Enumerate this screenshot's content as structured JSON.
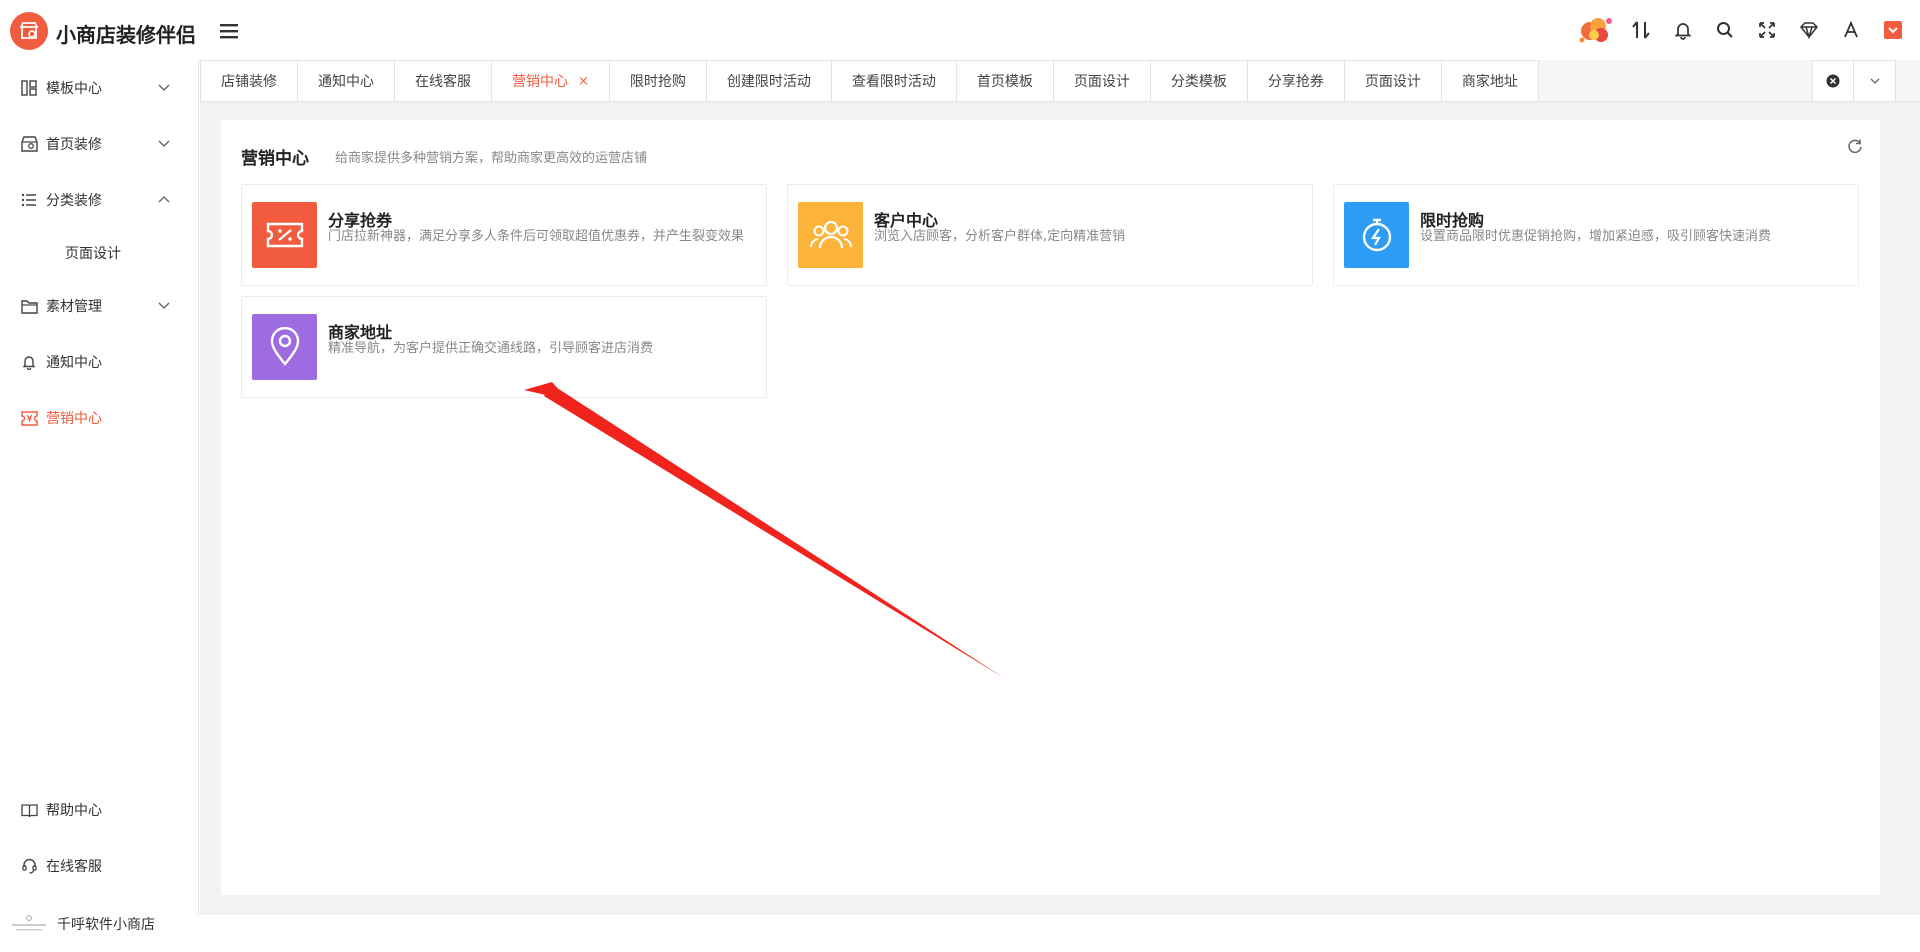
{
  "app": {
    "title": "小商店装修伴侣"
  },
  "colors": {
    "accent": "#f15b3e",
    "orange": "#fbb33a",
    "blue": "#2d9cf5",
    "purple": "#9d6ce0",
    "arrow": "#f0241c"
  },
  "toolbar": {
    "icons": [
      "avatar",
      "sort-icon",
      "bell-icon",
      "search-icon",
      "fullscreen-icon",
      "diamond-icon",
      "font-icon",
      "theme-icon"
    ]
  },
  "sidebar": {
    "items": [
      {
        "label": "模板中心",
        "icon": "template-icon",
        "expandable": true
      },
      {
        "label": "首页装修",
        "icon": "home-decor-icon",
        "expandable": true
      },
      {
        "label": "分类装修",
        "icon": "list-icon",
        "expandable": true,
        "expanded": true
      },
      {
        "label": "页面设计",
        "sub": true
      },
      {
        "label": "素材管理",
        "icon": "folder-icon",
        "expandable": true
      },
      {
        "label": "通知中心",
        "icon": "bell-icon"
      },
      {
        "label": "营销中心",
        "icon": "ticket-icon",
        "active": true
      }
    ],
    "bottom": [
      {
        "label": "帮助中心",
        "icon": "book-icon"
      },
      {
        "label": "在线客服",
        "icon": "headset-icon"
      },
      {
        "label": "千呼软件小商店",
        "icon": "brand-logo"
      }
    ]
  },
  "tabs": [
    {
      "label": "店铺装修"
    },
    {
      "label": "通知中心"
    },
    {
      "label": "在线客服"
    },
    {
      "label": "营销中心",
      "active": true,
      "close": "×"
    },
    {
      "label": "限时抢购"
    },
    {
      "label": "创建限时活动"
    },
    {
      "label": "查看限时活动"
    },
    {
      "label": "首页模板"
    },
    {
      "label": "页面设计"
    },
    {
      "label": "分类模板"
    },
    {
      "label": "分享抢券"
    },
    {
      "label": "页面设计"
    },
    {
      "label": "商家地址"
    }
  ],
  "page": {
    "title": "营销中心",
    "description": "给商家提供多种营销方案，帮助商家更高效的运营店铺"
  },
  "cards": [
    {
      "title": "分享抢券",
      "desc": "门店拉新神器，满足分享多人条件后可领取超值优惠券，并产生裂变效果",
      "icon": "coupon-icon",
      "color": "#f15b3e"
    },
    {
      "title": "客户中心",
      "desc": "浏览入店顾客，分析客户群体,定向精准营销",
      "icon": "users-icon",
      "color": "#fbb33a"
    },
    {
      "title": "限时抢购",
      "desc": "设置商品限时优惠促销抢购，增加紧迫感，吸引顾客快速消费",
      "icon": "stopwatch-icon",
      "color": "#2d9cf5"
    },
    {
      "title": "商家地址",
      "desc": "精准导航，为客户提供正确交通线路，引导顾客进店消费",
      "icon": "location-icon",
      "color": "#9d6ce0"
    }
  ]
}
